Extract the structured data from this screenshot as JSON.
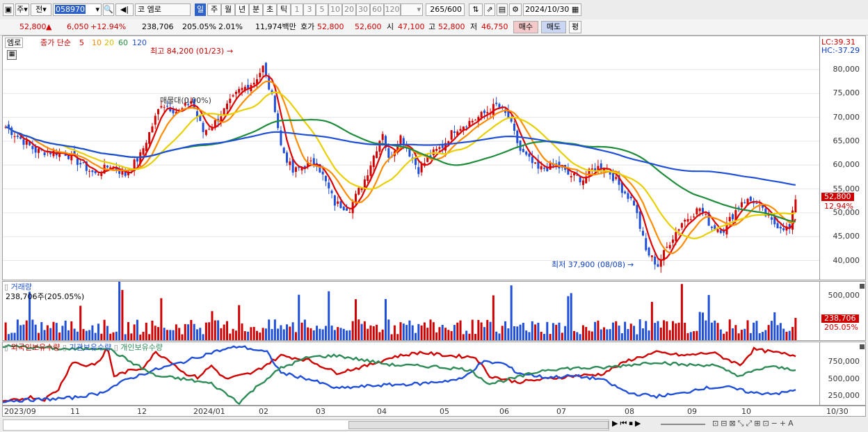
{
  "toolbar": {
    "period_type": "주",
    "prev_label": "전",
    "stock_code": "058970",
    "market": "코",
    "stock_name": "엠로",
    "tabs": [
      "일",
      "주",
      "월",
      "년",
      "분",
      "초",
      "틱"
    ],
    "intervals": [
      "1",
      "3",
      "5",
      "10",
      "20",
      "30",
      "60",
      "120"
    ],
    "count": "265",
    "count_max": "/600",
    "date": "2024/10/30"
  },
  "quote": {
    "price": "52,800",
    "change": "6,050",
    "change_pct": "+12.94%",
    "volume": "238,706",
    "volume_ratio": "205.05%",
    "turnover": "2.01%",
    "amount": "11,974백만",
    "bid_label": "호가",
    "bid1": "52,800",
    "bid2": "52,600",
    "open_label": "시",
    "open": "47,100",
    "high_label": "고",
    "high": "52,800",
    "low_label": "저",
    "low": "46,750",
    "buy_label": "매수",
    "sell_label": "매도",
    "eval_label": "평"
  },
  "price_panel": {
    "name": "엠로",
    "ma_label": "종가 단순",
    "ma_periods": [
      "5",
      "10",
      "20",
      "60",
      "120"
    ],
    "ma_colors": [
      "#e00000",
      "#ff8c00",
      "#e8d000",
      "#1e8c3a",
      "#1f4fd8"
    ],
    "hi_note": "최고 84,200 (01/23)",
    "lo_note": "최저 37,900 (08/08)",
    "tooltip": "매물대(0.00%)",
    "lc": "LC:39.31",
    "hc": "HC:-37.29",
    "y_ticks": [
      "80,000",
      "75,000",
      "70,000",
      "65,000",
      "60,000",
      "55,000",
      "50,000",
      "45,000",
      "40,000"
    ],
    "last_price": "52,800",
    "last_pct": "12.94%"
  },
  "volume_panel": {
    "name": "거래량",
    "info": "238,706주(205.05%)",
    "y_ticks": [
      "500,000",
      "250,000"
    ],
    "last": "238,706",
    "last_pct": "205.05%"
  },
  "holdings_panel": {
    "series": [
      "외국인보유수량",
      "기관보유수량",
      "개인보유수량"
    ],
    "colors": [
      "#d00000",
      "#1f4fd8",
      "#2e8b57"
    ],
    "y_ticks": [
      "750,000",
      "500,000",
      "250,000"
    ]
  },
  "x_axis": {
    "labels": [
      "2023/09",
      "11",
      "12",
      "2024/01",
      "02",
      "03",
      "04",
      "05",
      "06",
      "07",
      "08",
      "09",
      "10"
    ],
    "end": "10/30"
  },
  "chart_data": {
    "type": "candlestick",
    "ylim": [
      36000,
      87000
    ],
    "price_anchors": [
      [
        0,
        68000
      ],
      [
        10,
        63000
      ],
      [
        20,
        62500
      ],
      [
        30,
        58000
      ],
      [
        35,
        60000
      ],
      [
        40,
        58000
      ],
      [
        45,
        62000
      ],
      [
        52,
        73000
      ],
      [
        58,
        71000
      ],
      [
        62,
        73500
      ],
      [
        66,
        67000
      ],
      [
        70,
        69000
      ],
      [
        78,
        75500
      ],
      [
        83,
        77500
      ],
      [
        86,
        80500
      ],
      [
        90,
        72000
      ],
      [
        92,
        64000
      ],
      [
        96,
        58500
      ],
      [
        100,
        60000
      ],
      [
        104,
        60500
      ],
      [
        110,
        52000
      ],
      [
        115,
        51000
      ],
      [
        120,
        57000
      ],
      [
        126,
        67000
      ],
      [
        128,
        61000
      ],
      [
        132,
        66000
      ],
      [
        138,
        59000
      ],
      [
        142,
        62000
      ],
      [
        146,
        64000
      ],
      [
        150,
        67500
      ],
      [
        158,
        70000
      ],
      [
        164,
        72500
      ],
      [
        168,
        70000
      ],
      [
        172,
        63000
      ],
      [
        178,
        59000
      ],
      [
        184,
        60000
      ],
      [
        188,
        58000
      ],
      [
        193,
        57000
      ],
      [
        196,
        59000
      ],
      [
        200,
        60000
      ],
      [
        206,
        55000
      ],
      [
        210,
        52000
      ],
      [
        214,
        42000
      ],
      [
        218,
        39000
      ],
      [
        222,
        44000
      ],
      [
        226,
        48000
      ],
      [
        232,
        51000
      ],
      [
        236,
        47000
      ],
      [
        240,
        46500
      ],
      [
        246,
        52500
      ],
      [
        250,
        52500
      ],
      [
        256,
        48000
      ],
      [
        262,
        46500
      ],
      [
        264,
        52800
      ]
    ],
    "last_close": 52800,
    "series_note": "5 moving averages shown"
  }
}
